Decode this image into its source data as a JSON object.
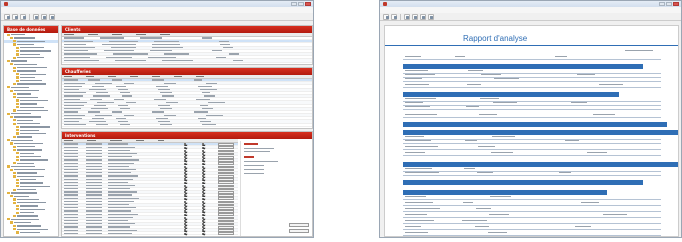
{
  "left_window": {
    "title": "",
    "menu": [
      "",
      "",
      "",
      "",
      ""
    ],
    "db_panel": {
      "title": "Base de données"
    },
    "clients_panel": {
      "title": "Clients"
    },
    "chaufferies_panel": {
      "title": "Chaufferies"
    },
    "interventions_panel": {
      "title": "Interventions"
    }
  },
  "right_window": {
    "title": "",
    "menu": [
      "",
      "",
      "",
      "",
      ""
    ],
    "report": {
      "title": "Rapport d'analyse"
    }
  }
}
